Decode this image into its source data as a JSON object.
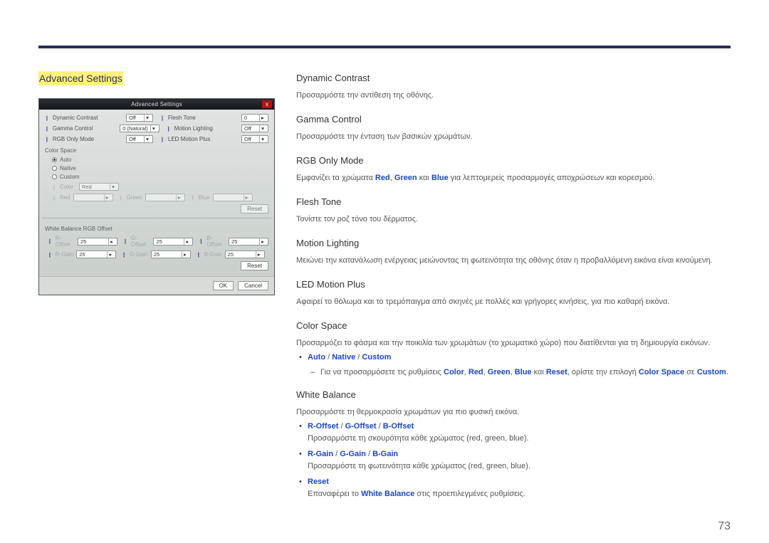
{
  "page": {
    "number": "73"
  },
  "section_title": "Advanced Settings",
  "panel": {
    "title": "Advanced Settings",
    "close": "x",
    "rows_top": [
      {
        "left_label": "Dynamic Contrast",
        "left_value": "Off",
        "right_label": "Flesh Tone",
        "right_value": "0"
      },
      {
        "left_label": "Gamma Control",
        "left_value": "0 (Natural)",
        "right_label": "Motion Lighting",
        "right_value": "Off"
      },
      {
        "left_label": "RGB Only Mode",
        "left_value": "Off",
        "right_label": "LED Motion Plus",
        "right_value": "Off"
      }
    ],
    "color_space": {
      "heading": "Color Space",
      "options": [
        "Auto",
        "Native",
        "Custom"
      ],
      "selected": "Auto",
      "custom": {
        "color_label": "Color",
        "color_value": "Red",
        "channels": [
          {
            "label": "Red",
            "value": ""
          },
          {
            "label": "Green",
            "value": ""
          },
          {
            "label": "Blue",
            "value": ""
          }
        ],
        "reset": "Reset"
      }
    },
    "wb": {
      "heading": "White Balance RGB Offset",
      "rows": [
        [
          {
            "label": "R-Offset",
            "value": "25"
          },
          {
            "label": "G-Offset",
            "value": "25"
          },
          {
            "label": "B-Offset",
            "value": "25"
          }
        ],
        [
          {
            "label": "R-Gain",
            "value": "25"
          },
          {
            "label": "G-Gain",
            "value": "25"
          },
          {
            "label": "B-Gain",
            "value": "25"
          }
        ]
      ],
      "reset": "Reset"
    },
    "footer": {
      "ok": "OK",
      "cancel": "Cancel"
    }
  },
  "docs": {
    "dynamic_contrast": {
      "h": "Dynamic Contrast",
      "p": "Προσαρμόστε την αντίθεση της οθόνης."
    },
    "gamma_control": {
      "h": "Gamma Control",
      "p": "Προσαρμόστε την ένταση των βασικών χρωμάτων."
    },
    "rgb_only_mode": {
      "h": "RGB Only Mode",
      "p_pre": "Εμφανίζει τα χρώματα ",
      "red": "Red",
      "sep1": ", ",
      "green": "Green",
      "sep2": " και ",
      "blue": "Blue",
      "p_post": " για λεπτομερείς προσαρμογές αποχρώσεων και κορεσμού."
    },
    "flesh_tone": {
      "h": "Flesh Tone",
      "p": "Τονίστε τον ροζ τόνο του δέρματος."
    },
    "motion_lighting": {
      "h": "Motion Lighting",
      "p": "Μειώνει την κατανάλωση ενέργειας μειώνοντας τη φωτεινότητα της οθόνης όταν η προβαλλόμενη εικόνα είναι κινούμενη."
    },
    "led_motion_plus": {
      "h": "LED Motion Plus",
      "p": "Αφαιρεί το θόλωμα και το τρεμόπαιγμα από σκηνές με πολλές και γρήγορες κινήσεις, για πιο καθαρή εικόνα."
    },
    "color_space": {
      "h": "Color Space",
      "p": "Προσαρμόζει το φάσμα και την ποικιλία των χρωμάτων (το χρωματικό χώρο) που διατίθενται για τη δημιουργία εικόνων.",
      "opts": {
        "auto": "Auto",
        "native": "Native",
        "custom": "Custom",
        "sep": " / "
      },
      "sub_pre": "Για να προσαρμόσετε τις ρυθμίσεις ",
      "kw": {
        "color": "Color",
        "red": "Red",
        "green": "Green",
        "blue": "Blue",
        "reset": "Reset",
        "cs": "Color Space",
        "custom": "Custom"
      },
      "sub_mid1": ", ",
      "sub_mid2": " και ",
      "sub_mid3": ", ορίστε την επιλογή ",
      "sub_mid4": " σε ",
      "sub_end": "."
    },
    "white_balance": {
      "h": "White Balance",
      "p": "Προσαρμόστε τη θερμοκρασία χρωμάτων για πιο φυσική εικόνα.",
      "b1": {
        "r": "R-Offset",
        "g": "G-Offset",
        "b": "B-Offset",
        "sep": " / ",
        "desc": "Προσαρμόστε τη σκουρότητα κάθε χρώματος (red, green, blue)."
      },
      "b2": {
        "r": "R-Gain",
        "g": "G-Gain",
        "b": "B-Gain",
        "sep": " / ",
        "desc": "Προσαρμόστε τη φωτεινότητα κάθε χρώματος (red, green, blue)."
      },
      "b3": {
        "reset": "Reset",
        "desc_pre": "Επαναφέρει το ",
        "wb": "White Balance",
        "desc_post": " στις προεπιλεγμένες ρυθμίσεις."
      }
    }
  }
}
